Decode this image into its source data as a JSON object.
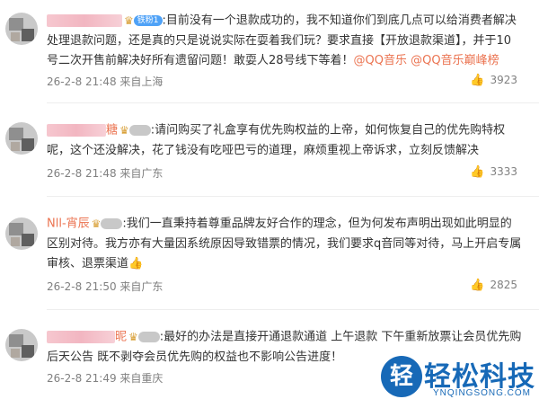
{
  "comments": [
    {
      "name": "",
      "badge": "铁粉1",
      "text": "目前没有一个退款成功的，我不知道你们到底几点可以给消费者解决处理退款问题，还是真的只是说说实际在耍着我们玩？要求直接【开放退款渠道】，并于10号二次开售前解决好所有遗留问题！敢耍人28号线下等着！",
      "mentions": "@QQ音乐 @QQ音乐巅峰榜",
      "meta": "26-2-8 21:48 来自上海",
      "likes": "3923"
    },
    {
      "name": "糖",
      "badge": "",
      "text": "请问购买了礼盒享有优先购权益的上帝，如何恢复自己的优先购特权呢，这个还没解决，花了钱没有吃哑巴亏的道理，麻烦重视上帝诉求，立刻反馈解决",
      "mentions": "",
      "meta": "26-2-8 21:48 来自广东",
      "likes": "3333"
    },
    {
      "name": "Nll-宵辰",
      "badge": "",
      "text": "我们一直秉持着尊重品牌友好合作的理念，但为何发布声明出现如此明显的区别对待。我方亦有大量因系统原因导致错票的情况，我们要求q音同等对待，马上开启专属审核、退票渠道👍",
      "mentions": "",
      "meta": "26-2-8 21:50 来自广东",
      "likes": "2825"
    },
    {
      "name": "昵",
      "badge": "",
      "text": "最好的办法是直接开通退款通道 上午退款 下午重新放票让会员优先购后天公告 既不剥夺会员优先购的权益也不影响公告进度！",
      "mentions": "",
      "meta": "26-2-8 21:49 来自重庆",
      "likes": ""
    }
  ],
  "watermark": {
    "logo": "轻",
    "title": "轻松科技",
    "url": "YNQINGSONG.COM"
  }
}
